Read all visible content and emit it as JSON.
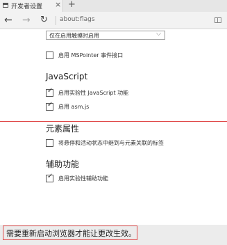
{
  "tab": {
    "title": "开发者设置",
    "close_glyph": "×",
    "new_tab_glyph": "+"
  },
  "address_bar": {
    "back_glyph": "←",
    "forward_glyph": "→",
    "refresh_glyph": "↻",
    "url": "about:flags"
  },
  "touch_select": {
    "selected": "仅在启用触摸时启用",
    "chevron_glyph": "⌵"
  },
  "options_top": [
    {
      "label": "启用 MSPointer 事件接口",
      "checked": false
    }
  ],
  "sections": {
    "javascript": {
      "heading": "JavaScript",
      "options": [
        {
          "label": "启用实验性 JavaScript 功能",
          "checked": true
        },
        {
          "label": "启用 asm.js",
          "checked": true
        }
      ]
    },
    "element_props": {
      "heading": "元素属性",
      "options": [
        {
          "label": "将悬停和活动状态中继到与元素关联的标签",
          "checked": false
        }
      ]
    },
    "accessibility": {
      "heading": "辅助功能",
      "options": [
        {
          "label": "启用实验性辅助功能",
          "checked": true
        }
      ]
    }
  },
  "check_glyph": "✓",
  "restart_banner": {
    "text": "需要重新启动浏览器才能让更改生效。"
  },
  "colors": {
    "highlight_red": "#e04848",
    "banner_bg": "#ececec"
  }
}
